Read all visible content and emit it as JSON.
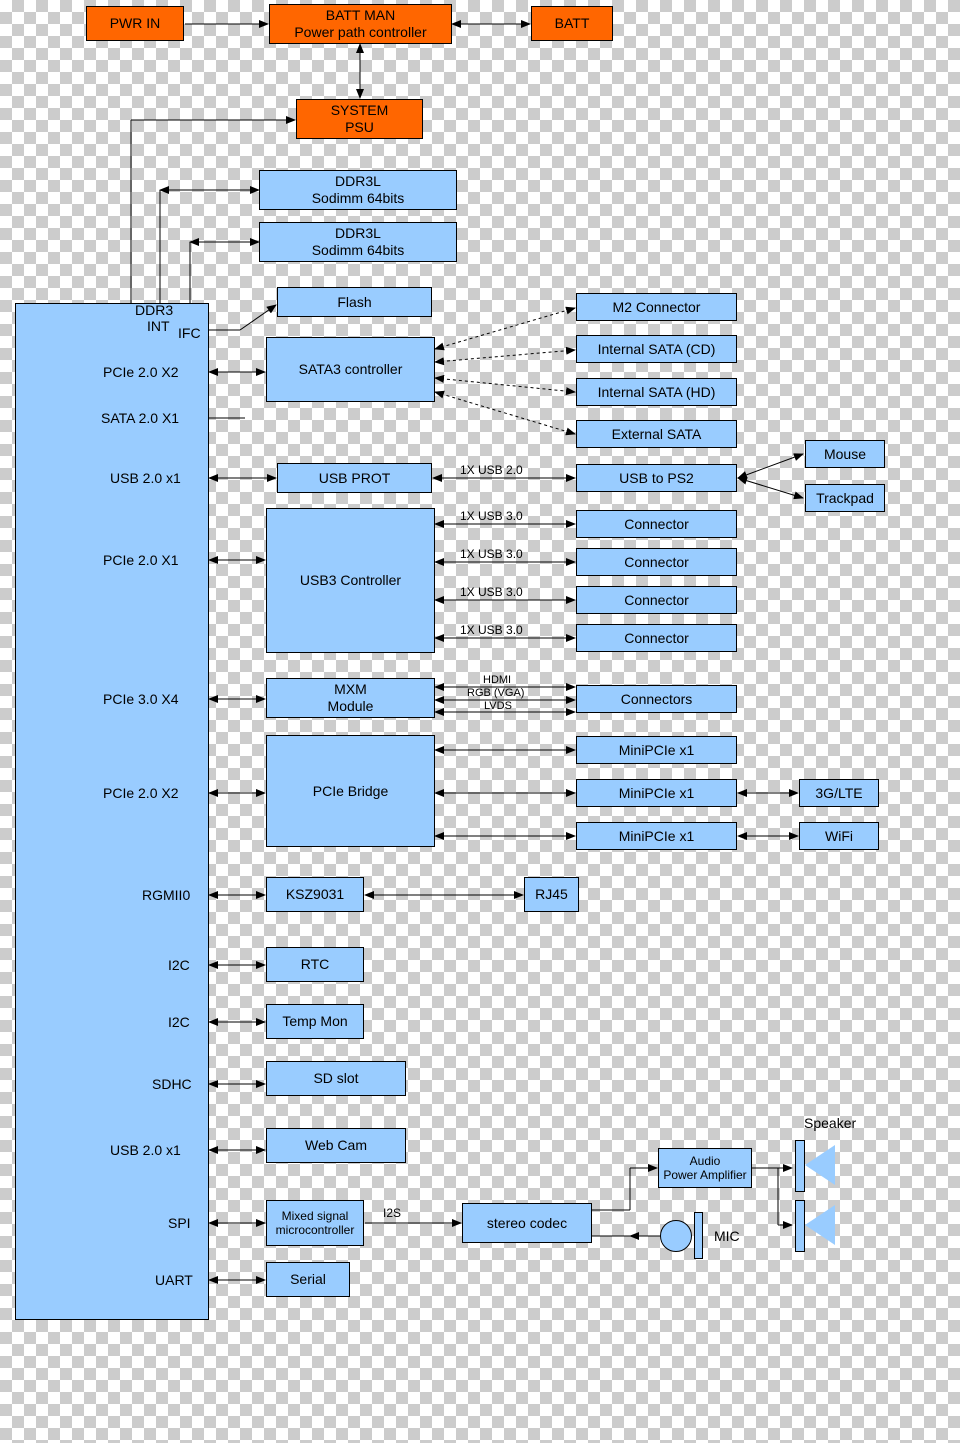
{
  "power": {
    "pwr_in": "PWR IN",
    "batt_man": "BATT MAN\nPower path controller",
    "batt": "BATT",
    "psu": "SYSTEM\nPSU"
  },
  "mem": {
    "ddr1": "DDR3L\nSodimm 64bits",
    "ddr2": "DDR3L\nSodimm 64bits"
  },
  "soc_ports": {
    "ddr3": "DDR3",
    "int": "INT",
    "ifc": "IFC",
    "pcie20x2_a": "PCIe 2.0 X2",
    "sata20x1": "SATA 2.0 X1",
    "usb20x1_a": "USB 2.0 x1",
    "pcie20x1": "PCIe 2.0 X1",
    "pcie30x4": "PCIe 3.0 X4",
    "pcie20x2_b": "PCIe 2.0 X2",
    "rgmii0": "RGMII0",
    "i2c_a": "I2C",
    "i2c_b": "I2C",
    "sdhc": "SDHC",
    "usb20x1_b": "USB 2.0 x1",
    "spi": "SPI",
    "uart": "UART"
  },
  "blocks": {
    "flash": "Flash",
    "sata3": "SATA3 controller",
    "usb_prot": "USB PROT",
    "usb3_ctrl": "USB3 Controller",
    "mxm": "MXM\nModule",
    "pcie_bridge": "PCIe Bridge",
    "ksz": "KSZ9031",
    "rj45": "RJ45",
    "rtc": "RTC",
    "temp_mon": "Temp Mon",
    "sd_slot": "SD slot",
    "webcam": "Web Cam",
    "mixed_sig": "Mixed signal\nmicrocontroller",
    "stereo_codec": "stereo codec",
    "serial": "Serial",
    "audio_pa": "Audio\nPower Amplifier"
  },
  "right": {
    "m2": "M2 Connector",
    "int_sata_cd": "Internal SATA (CD)",
    "int_sata_hd": "Internal SATA (HD)",
    "ext_sata": "External SATA",
    "usb_ps2": "USB to PS2",
    "conn1": "Connector",
    "conn2": "Connector",
    "conn3": "Connector",
    "conn4": "Connector",
    "mxm_conn": "Connectors",
    "minipcie1": "MiniPCIe x1",
    "minipcie2": "MiniPCIe x1",
    "minipcie3": "MiniPCIe x1",
    "mouse": "Mouse",
    "trackpad": "Trackpad",
    "lte": "3G/LTE",
    "wifi": "WiFi"
  },
  "bus_labels": {
    "usb20_1x": "1X USB 2.0",
    "usb30_1x_a": "1X USB 3.0",
    "usb30_1x_b": "1X USB 3.0",
    "usb30_1x_c": "1X USB 3.0",
    "usb30_1x_d": "1X USB 3.0",
    "hdmi": "HDMI",
    "rgb": "RGB (VGA)",
    "lvds": "LVDS",
    "i2s": "I2S"
  },
  "audio": {
    "speaker": "Speaker",
    "mic": "MIC"
  }
}
